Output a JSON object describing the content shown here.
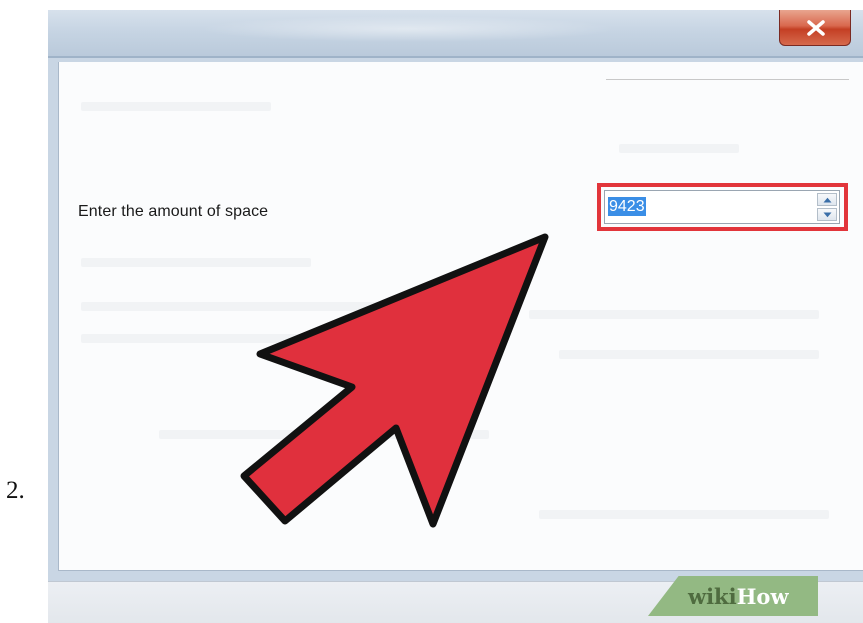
{
  "step": {
    "number": "2."
  },
  "window": {
    "close_icon": "close-x-icon"
  },
  "dialog": {
    "space_label": "Enter the amount of space",
    "space_value": "9423",
    "spin_up_icon": "chevron-up-icon",
    "spin_down_icon": "chevron-down-icon"
  },
  "overlay": {
    "arrow_icon": "pointer-arrow-icon",
    "arrow_color": "#e0303d",
    "highlight_color": "#e2353b"
  },
  "watermark": {
    "part1": "wiki",
    "part2": "How"
  }
}
